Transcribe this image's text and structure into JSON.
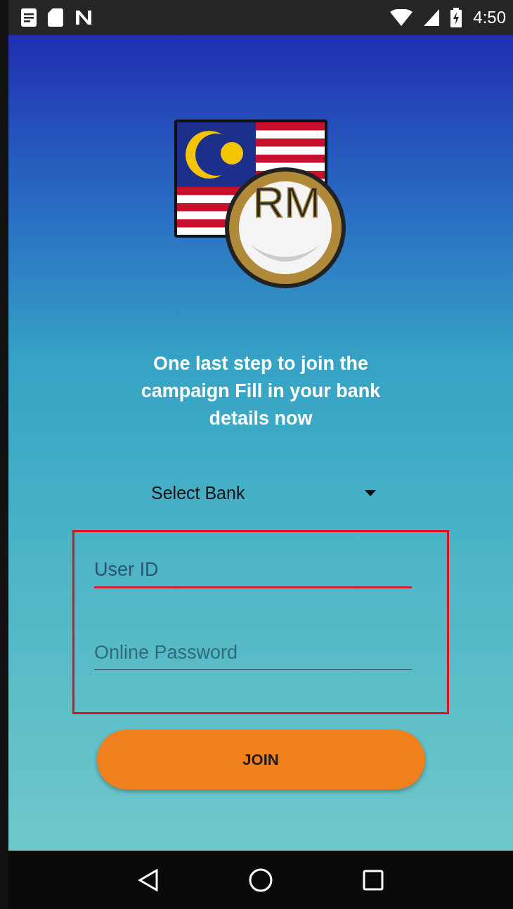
{
  "status_bar": {
    "time": "4:50"
  },
  "logo_text": "RM",
  "heading": "One last step to join the campaign Fill in your bank details now",
  "bank_select": {
    "value": "Select Bank"
  },
  "fields": [
    {
      "placeholder": "User ID",
      "focused": true
    },
    {
      "placeholder": "Online Password",
      "focused": false
    }
  ],
  "join_button": "JOIN"
}
